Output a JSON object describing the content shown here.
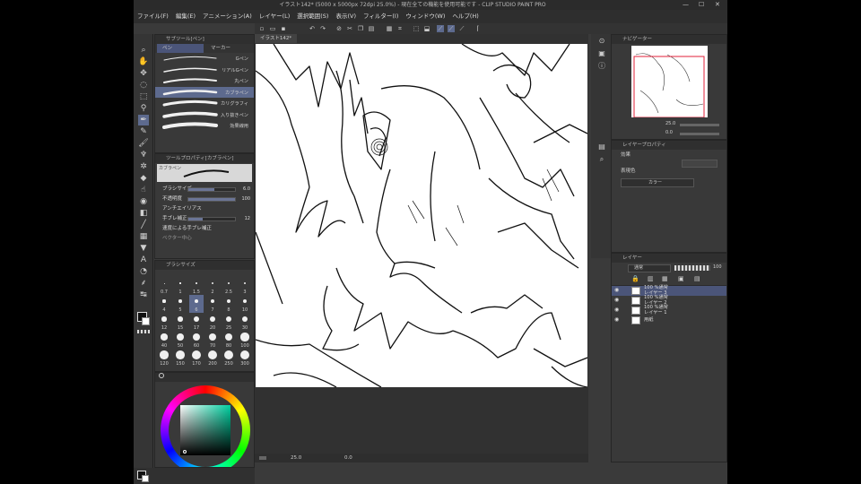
{
  "window": {
    "title": "イラスト142* (5000 x 5000px 72dpi 25.0%)  - 現在全ての機能を使用可能です - CLIP STUDIO PAINT PRO",
    "minimize": "—",
    "maximize": "☐",
    "close": "✕"
  },
  "menu": {
    "items": [
      "ファイル(F)",
      "編集(E)",
      "アニメーション(A)",
      "レイヤー(L)",
      "選択範囲(S)",
      "表示(V)",
      "フィルター(I)",
      "ウィンドウ(W)",
      "ヘルプ(H)"
    ]
  },
  "subtool_panel": {
    "header": "サブツール[ペン]",
    "tabs": [
      "ペン",
      "マーカー"
    ],
    "brushes": [
      "Gペン",
      "リアルGペン",
      "丸ペン",
      "カブラペン",
      "カリグラフィ",
      "入り抜きペン",
      "効果線用"
    ],
    "selected_index": 3
  },
  "tool_property": {
    "header": "ツールプロパティ[カブラペン]",
    "preview_label": "カブラペン",
    "rows": [
      {
        "label": "ブラシサイズ",
        "value": "6.0",
        "fill": 0.55
      },
      {
        "label": "不透明度",
        "value": "100",
        "fill": 1.0
      },
      {
        "label": "アンチエイリアス",
        "value": "",
        "fill": 0
      },
      {
        "label": "手ブレ補正",
        "value": "12",
        "fill": 0.3
      },
      {
        "label": "速度による手ブレ補正",
        "value": "",
        "fill": 0
      }
    ],
    "last_row": "ベクター中心"
  },
  "brush_size_panel": {
    "header": "ブラシサイズ",
    "sizes": [
      "0.7",
      "1",
      "1.5",
      "2",
      "2.5",
      "3",
      "4",
      "5",
      "6",
      "7",
      "8",
      "10",
      "12",
      "15",
      "17",
      "20",
      "25",
      "30",
      "40",
      "50",
      "60",
      "70",
      "80",
      "100",
      "120",
      "150",
      "170",
      "200",
      "250",
      "300"
    ],
    "selected": "6"
  },
  "canvas": {
    "tab_label": "イラスト142*",
    "zoom": "25.0",
    "angle": "0.0"
  },
  "navigator": {
    "header": "ナビゲーター",
    "zoom": "25.0",
    "rotation": "0.0"
  },
  "layer_property": {
    "header": "レイヤープロパティ",
    "effect_label": "効果",
    "color_label": "表現色",
    "color_value": "カラー"
  },
  "layers": {
    "header": "レイヤー",
    "blend_mode": "通常",
    "opacity": "100",
    "items": [
      {
        "mode": "100 %通常",
        "name": "レイヤー 3",
        "selected": true
      },
      {
        "mode": "100 %通常",
        "name": "レイヤー 2",
        "selected": false
      },
      {
        "mode": "100 %通常",
        "name": "レイヤー 1",
        "selected": false
      },
      {
        "mode": "",
        "name": "用紙",
        "selected": false
      }
    ]
  },
  "color": {
    "main": "#111111",
    "sub": "#ffffff",
    "wheel_hue": "#00d0a0"
  },
  "icons": {
    "tools": [
      "zoom-icon",
      "hand-icon",
      "move-icon",
      "lasso-icon",
      "select-icon",
      "eyedropper-icon",
      "pen-icon",
      "pencil-icon",
      "brush-icon",
      "airbrush-icon",
      "decorate-icon",
      "eraser-icon",
      "blend-icon",
      "fill-icon",
      "gradient-icon",
      "figure-icon",
      "frame-icon",
      "ruler-icon",
      "text-icon",
      "balloon-icon",
      "line-correct-icon",
      "correct-icon"
    ]
  }
}
